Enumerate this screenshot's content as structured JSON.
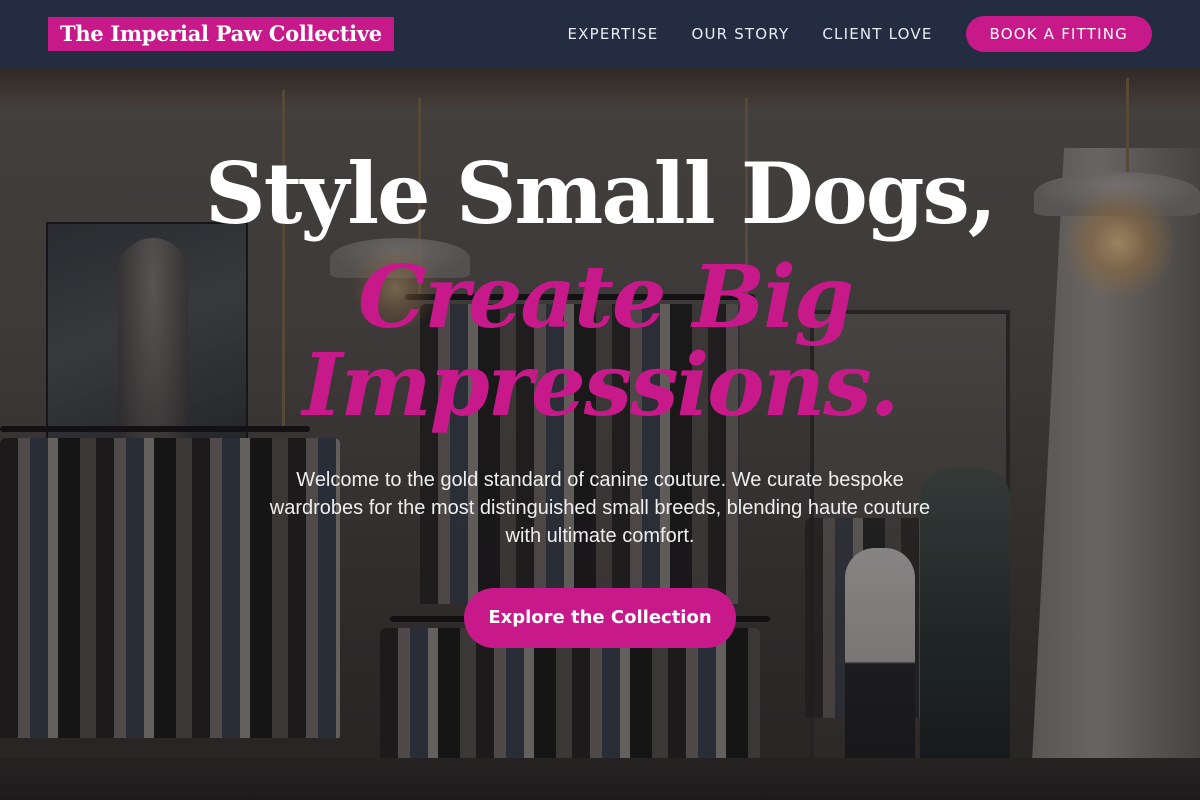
{
  "nav": {
    "logo": "The Imperial Paw Collective",
    "links": [
      {
        "label": "EXPERTISE"
      },
      {
        "label": "OUR STORY"
      },
      {
        "label": "CLIENT LOVE"
      }
    ],
    "cta_label": "BOOK A FITTING"
  },
  "hero": {
    "headline_line1": "Style Small Dogs,",
    "headline_accent_line1": "Create Big",
    "headline_accent_line2": "Impressions.",
    "intro": "Welcome to the gold standard of canine couture. We curate bespoke wardrobes for the most distinguished small breeds, blending haute couture with ultimate comfort.",
    "cta_label": "Explore the Collection"
  },
  "colors": {
    "accent": "#c8198a",
    "nav_background": "#232c40",
    "text_light": "#ffffff"
  }
}
